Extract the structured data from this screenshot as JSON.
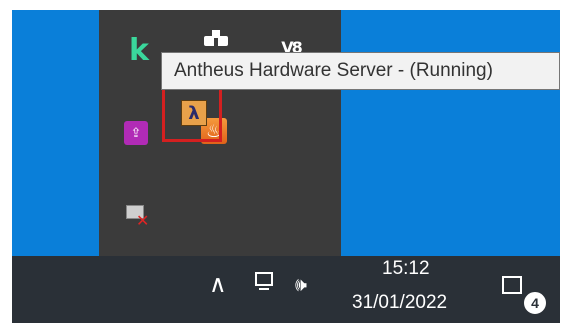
{
  "tray_overflow": {
    "icons": {
      "kahoot": "k",
      "purple_glyph": "⇪",
      "java_glyph": "♨",
      "antheus_glyph": "λ",
      "wmark": "V8"
    },
    "tooltip": "Antheus Hardware Server - (Running)"
  },
  "taskbar": {
    "time": "15:12",
    "date": "31/01/2022",
    "notification_count": "4",
    "chevron": "∧",
    "volume": "🕪"
  },
  "colors": {
    "desktop": "#0a7fd9",
    "tray_bg": "#3b3b3b",
    "taskbar_bg": "#2a3037",
    "highlight": "#d42020"
  }
}
